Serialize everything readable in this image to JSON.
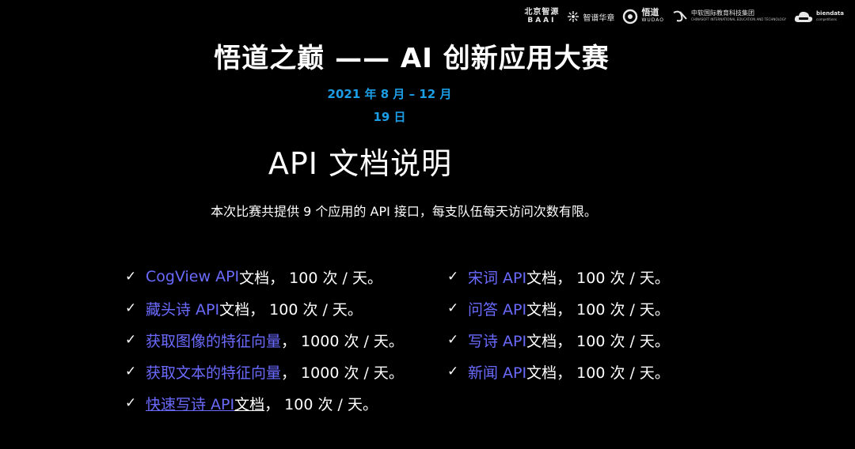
{
  "logos": [
    {
      "name": "baai",
      "cn": "北京智源",
      "en": "BAAI"
    },
    {
      "name": "zhipu",
      "text": "智谱华章"
    },
    {
      "name": "wudao",
      "text": "悟道",
      "sub": "WUDAO"
    },
    {
      "name": "zhongke",
      "text": "中软国际教育科技集团",
      "sub": "CHINASOFT INTERNATIONAL EDUCATION AND TECHNOLOGY"
    },
    {
      "name": "biendata",
      "text": "biendata",
      "sub": "competitions"
    }
  ],
  "title": "悟道之巅 —— AI 创新应用大赛",
  "date": {
    "line1": "2021 年 8 月  –  12 月",
    "line2": "19 日"
  },
  "subtitle": "API  文档说明",
  "description": "本次比赛共提供 9 个应用的 API 接口，每支队伍每天访问次数有限。",
  "left_items": [
    {
      "name": "CogView API",
      "rest": " 文档， 100 次 / 天。"
    },
    {
      "name": "藏头诗 API",
      "rest": " 文档， 100 次 / 天。"
    },
    {
      "name": "获取图像的特征向量",
      "rest": "， 1000 次 / 天。"
    },
    {
      "name": "获取文本的特征向量",
      "rest": "， 1000 次 / 天。"
    },
    {
      "name": "快速写诗 API",
      "doc": " 文档",
      "rest": "， 100 次 / 天。"
    }
  ],
  "right_items": [
    {
      "name": "宋词 API",
      "rest": " 文档， 100 次 / 天。"
    },
    {
      "name": "问答 API",
      "rest": " 文档， 100 次 / 天。"
    },
    {
      "name": "写诗 API",
      "rest": " 文档， 100 次 / 天。"
    },
    {
      "name": "新闻 API",
      "rest": " 文档， 100 次 / 天。"
    }
  ],
  "check_glyph": "✓",
  "colors": {
    "background": "#000000",
    "accent_blue": "#1c9ee6",
    "api_name": "#6a6aff",
    "text": "#ffffff"
  }
}
